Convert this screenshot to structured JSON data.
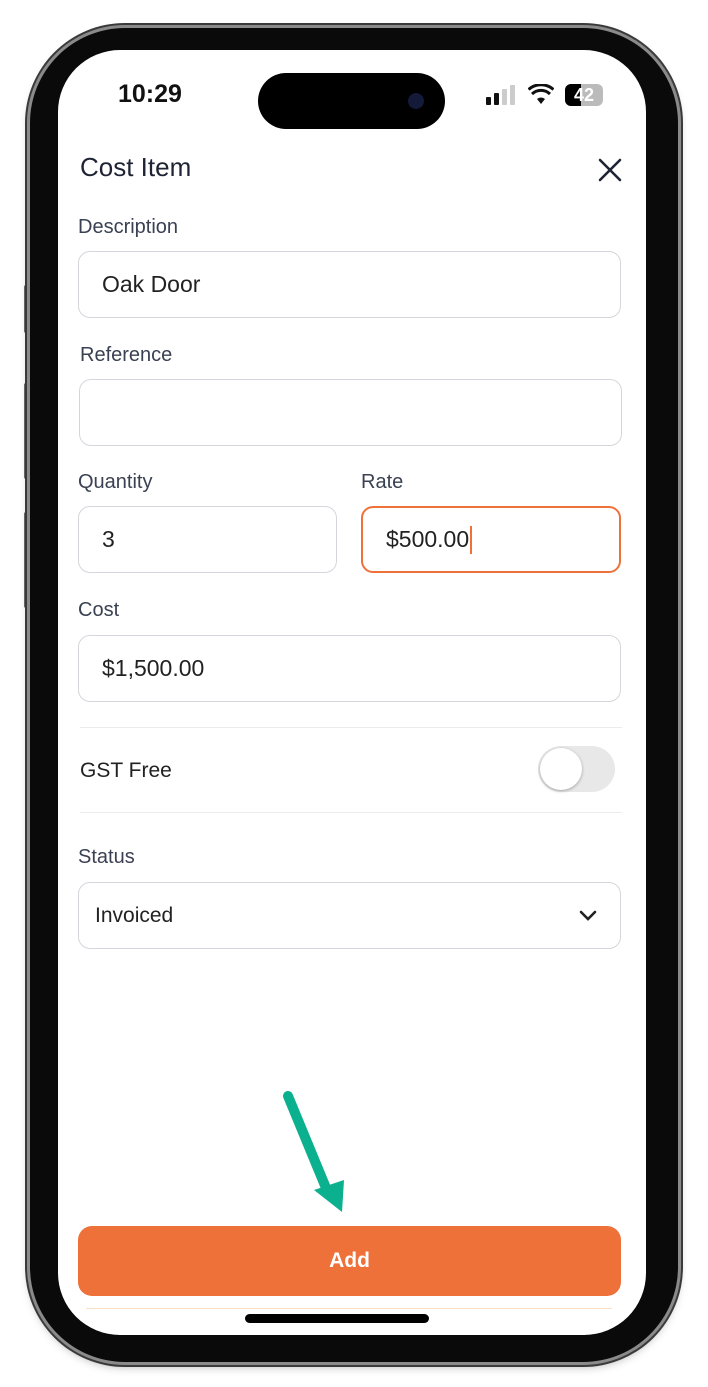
{
  "status_bar": {
    "time": "10:29",
    "battery": "42",
    "icons": [
      "signal-icon",
      "wifi-icon",
      "battery-icon"
    ]
  },
  "header": {
    "title": "Cost Item",
    "close_icon": "close-icon"
  },
  "form": {
    "description": {
      "label": "Description",
      "value": "Oak Door"
    },
    "reference": {
      "label": "Reference",
      "value": ""
    },
    "quantity": {
      "label": "Quantity",
      "value": "3"
    },
    "rate": {
      "label": "Rate",
      "value": "$500.00",
      "focused": true
    },
    "cost": {
      "label": "Cost",
      "value": "$1,500.00"
    },
    "gst_free": {
      "label": "GST Free",
      "on": false
    },
    "status": {
      "label": "Status",
      "value": "Invoiced"
    }
  },
  "footer": {
    "add_label": "Add"
  },
  "colors": {
    "accent": "#ee7139",
    "annotation_arrow": "#0bb08f"
  }
}
